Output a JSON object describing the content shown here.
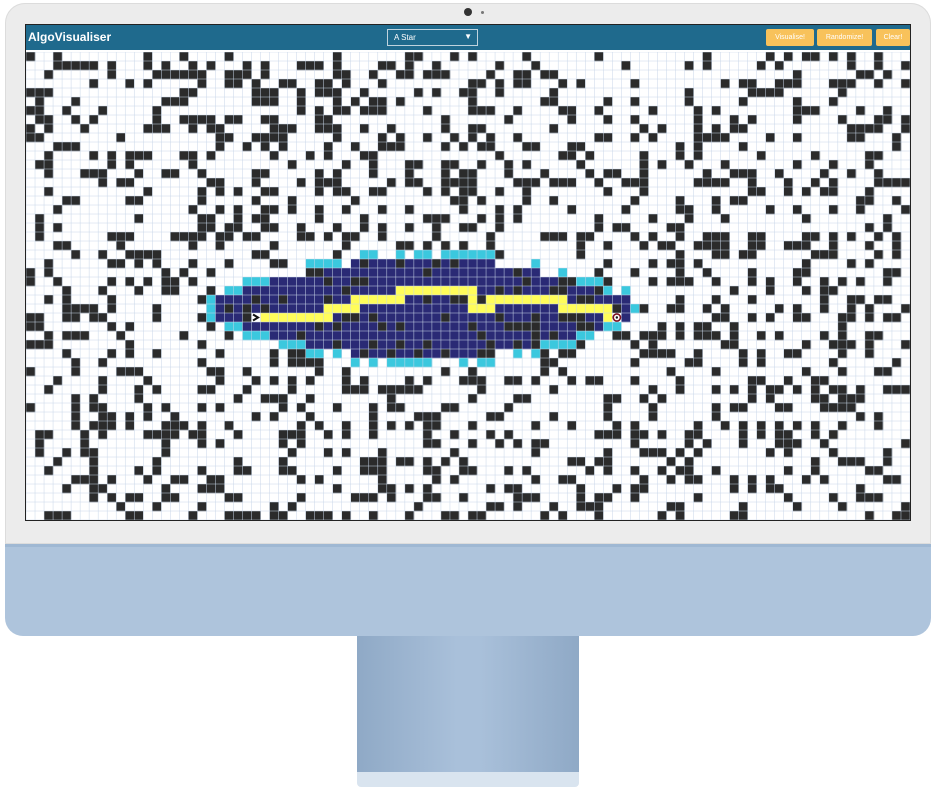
{
  "app": {
    "brand": "AlgoVisualiser"
  },
  "toolbar": {
    "algorithm": "A Star",
    "visualise_label": "Visualise!",
    "randomize_label": "Randomize!",
    "clear_label": "Clear!"
  },
  "colors": {
    "navbar": "#1f6a8d",
    "button": "#f8c25b",
    "wall": "#2b2b2b",
    "visited": "#2a2a75",
    "frontier": "#3bc8de",
    "path": "#fffd5a",
    "grid_line": "#c8d6e8",
    "monitor_chin": "#aec4dc"
  },
  "icons": {
    "start": "chevron-right-icon",
    "target": "target-icon",
    "dropdown": "caret-down-icon"
  },
  "grid": {
    "cols": 98,
    "rows": 52,
    "wall_density": 0.28,
    "start": [
      25,
      29
    ],
    "target": [
      65,
      29
    ]
  }
}
